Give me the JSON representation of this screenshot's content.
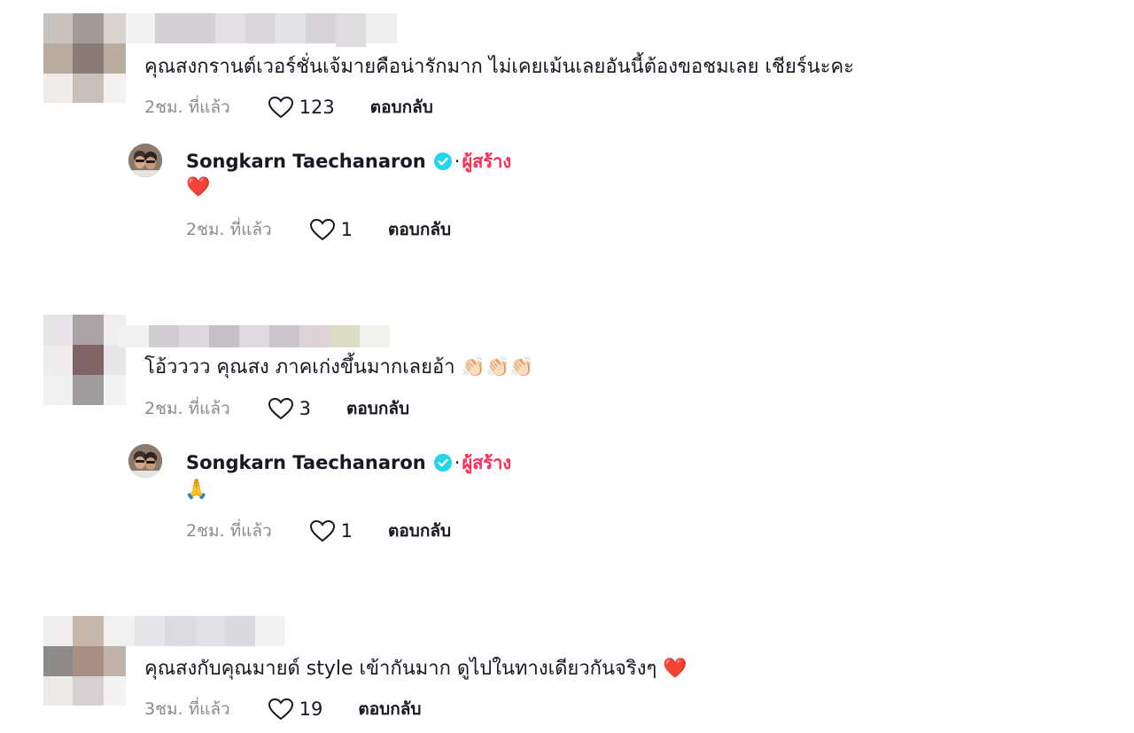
{
  "comments": [
    {
      "text": "คุณสงกรานต์เวอร์ชั่นเจ้มายคือน่ารักมาก ไม่เคยเม้นเลยอันนี้ต้องขอชมเลย เชียร์นะคะ",
      "time": "2ชม. ที่แล้ว",
      "likes": "123",
      "reply_label": "ตอบกลับ",
      "reply": {
        "username": "Songkarn Taechanaron",
        "separator": "·",
        "creator_label": "ผู้สร้าง",
        "text": "❤️",
        "time": "2ชม. ที่แล้ว",
        "likes": "1",
        "reply_label": "ตอบกลับ"
      }
    },
    {
      "text": "โอ้วววว คุณสง ภาคเก่งขึ้นมากเลยอ้า 👏🏻👏🏻👏🏻",
      "time": "2ชม. ที่แล้ว",
      "likes": "3",
      "reply_label": "ตอบกลับ",
      "reply": {
        "username": "Songkarn Taechanaron",
        "separator": "·",
        "creator_label": "ผู้สร้าง",
        "text": "🙏",
        "time": "2ชม. ที่แล้ว",
        "likes": "1",
        "reply_label": "ตอบกลับ"
      }
    },
    {
      "text": "คุณสงกับคุณมายด์ style เข้ากันมาก ดูไปในทางเดียวกันจริงๆ ❤️",
      "time": "3ชม. ที่แล้ว",
      "likes": "19",
      "reply_label": "ตอบกลับ"
    }
  ],
  "colors": {
    "creator_accent": "#fe2c55",
    "verified_badge": "#20d5ec",
    "meta_gray": "#8a8b91",
    "text_primary": "#161823"
  },
  "icons": {
    "like": "heart-outline-icon",
    "verified": "verified-badge-icon"
  }
}
